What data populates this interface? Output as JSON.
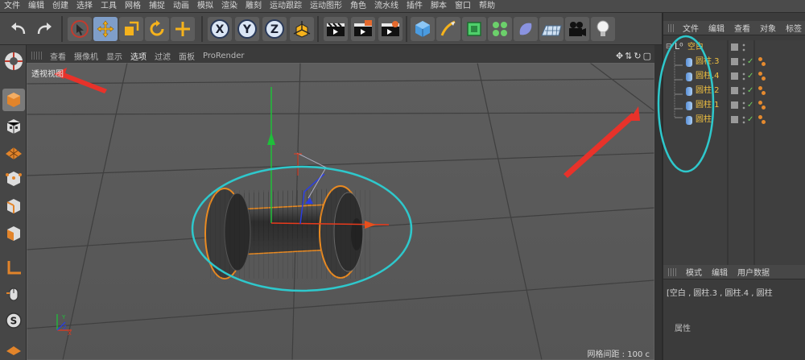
{
  "menu": [
    "文件",
    "编辑",
    "创建",
    "选择",
    "工具",
    "网格",
    "捕捉",
    "动画",
    "模拟",
    "渲染",
    "雕刻",
    "运动跟踪",
    "运动图形",
    "角色",
    "流水线",
    "插件",
    "脚本",
    "窗口",
    "帮助"
  ],
  "toolbar_icons": [
    "undo-icon",
    "redo-icon",
    "live-select-icon",
    "move-icon",
    "scale-icon",
    "rotate-icon",
    "move-add-icon",
    "x-axis-lock-icon",
    "y-axis-lock-icon",
    "z-axis-lock-icon",
    "world-coordinate-icon",
    "render-view-icon",
    "render-picture-viewer-icon",
    "render-settings-icon",
    "cube-primitive-icon",
    "pen-spline-icon",
    "subdivision-icon",
    "cloner-icon",
    "deformer-icon",
    "floor-icon",
    "camera-icon",
    "light-icon"
  ],
  "axis_letters": {
    "x": "X",
    "y": "Y",
    "z": "Z"
  },
  "viewport": {
    "menu": [
      "查看",
      "摄像机",
      "显示",
      "选项",
      "过滤",
      "面板",
      "ProRender"
    ],
    "selected_menu": "选项",
    "label": "透视视图",
    "grid_readout": "网格间距 : 100 c",
    "nav_icons": [
      "move-view-icon",
      "dolly-icon",
      "rotate-view-icon",
      "toggle-view-icon"
    ]
  },
  "objects_panel": {
    "tabs": [
      "文件",
      "编辑",
      "查看",
      "对象",
      "标签"
    ],
    "root": {
      "name": "空白",
      "icon": "null-object-icon"
    },
    "children": [
      "圆柱.3",
      "圆柱.4",
      "圆柱.2",
      "圆柱.1",
      "圆柱"
    ],
    "check_mark": "✓"
  },
  "attributes_panel": {
    "tabs": [
      "模式",
      "编辑",
      "用户数据"
    ],
    "path": "[空白 , 圆柱.3 , 圆柱.4 , 圆柱",
    "sub_label": "属性"
  },
  "annotation_colors": {
    "ellipse": "#2ec8cc",
    "arrow": "#e8322a"
  },
  "colors": {
    "active_button": "#7f9ec9",
    "object_name": "#f0c040",
    "check": "#6fd05f",
    "tag": "#e58a2e"
  }
}
